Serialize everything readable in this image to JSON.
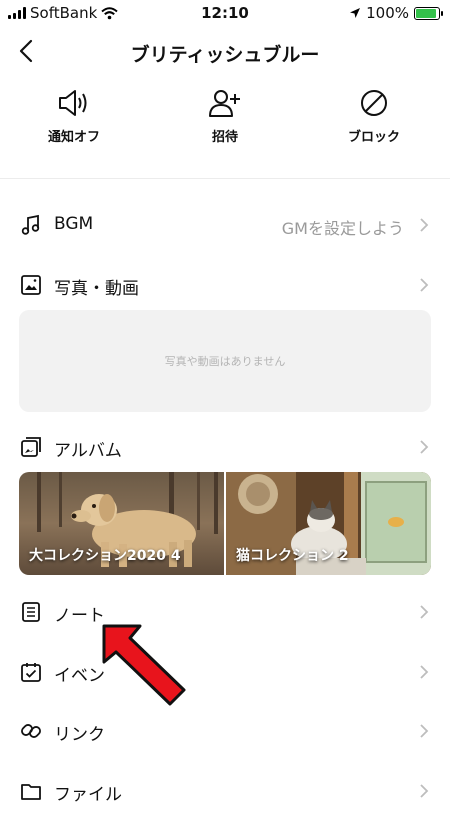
{
  "status_bar": {
    "carrier": "SoftBank",
    "time": "12:10",
    "battery": "100%",
    "battery_level": 1.0
  },
  "header": {
    "title": "ブリティッシュブルー"
  },
  "actions": [
    {
      "label": "通知オフ",
      "icon": "speaker-icon"
    },
    {
      "label": "招待",
      "icon": "add-user-icon"
    },
    {
      "label": "ブロック",
      "icon": "block-icon"
    }
  ],
  "menu": {
    "bgm": {
      "label": "BGM",
      "value": "GMを設定しよう"
    },
    "photos": {
      "label": "写真・動画",
      "empty_text": "写真や動画はありません"
    },
    "album": {
      "label": "アルバム"
    },
    "note": {
      "label": "ノート"
    },
    "event": {
      "label": "イベン"
    },
    "link": {
      "label": "リンク"
    },
    "file": {
      "label": "ファイル"
    }
  },
  "albums": [
    {
      "caption": "大コレクション2020 4"
    },
    {
      "caption": "猫コレクション 2"
    }
  ],
  "colors": {
    "accent_arrow": "#e8141c",
    "battery": "#33c14a",
    "divider": "#ececec"
  }
}
